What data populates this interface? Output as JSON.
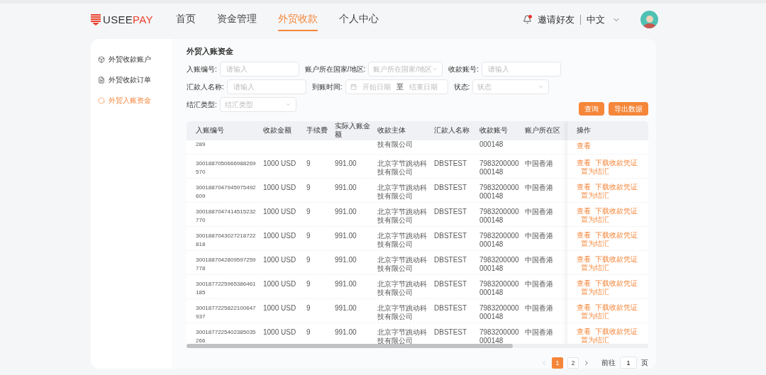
{
  "logo": {
    "parts": [
      "USEE",
      "PAY"
    ]
  },
  "nav": [
    {
      "label": "首页",
      "selected": false
    },
    {
      "label": "资金管理",
      "selected": false
    },
    {
      "label": "外贸收款",
      "selected": true
    },
    {
      "label": "个人中心",
      "selected": false
    }
  ],
  "header": {
    "invite": "邀请好友",
    "unread": true,
    "language": "中文"
  },
  "sidebar": {
    "items": [
      {
        "label": "外贸收款账户",
        "selected": false
      },
      {
        "label": "外贸收款订单",
        "selected": false
      },
      {
        "label": "外贸入账资金",
        "selected": true
      }
    ]
  },
  "page_title": "外贸入账资金",
  "filters": [
    {
      "kind": "input",
      "label": "入账编号:",
      "placeholder": "请输入"
    },
    {
      "kind": "select",
      "label": "账户所在国家/地区:",
      "placeholder": "账户所在国家/地区"
    },
    {
      "kind": "input",
      "label": "收款账号:",
      "placeholder": "请输入"
    },
    {
      "kind": "input",
      "label": "汇款人名称:",
      "placeholder": "请输入"
    },
    {
      "kind": "daterange",
      "label": "到账时间:",
      "start": "开始日期",
      "separator": "至",
      "end": "结束日期"
    },
    {
      "kind": "select",
      "label": "状态:",
      "placeholder": "状态"
    },
    {
      "kind": "select",
      "label": "结汇类型:",
      "placeholder": "结汇类型"
    }
  ],
  "buttons": [
    "查询",
    "导出数据"
  ],
  "table": {
    "columns": [
      "入账编号",
      "收款金额",
      "手续费",
      "实际入账金额",
      "收款主体",
      "汇款人名称",
      "收款账号",
      "账户所在区",
      "操作"
    ],
    "rows": [
      {
        "cells": [
          "289",
          "",
          "",
          "",
          "技有限公司",
          "",
          "000148",
          ""
        ],
        "actions": [
          "查看"
        ],
        "partial": true
      },
      {
        "cells": [
          "3001887050666988269570",
          "1000 USD",
          "9",
          "991.00",
          "北京字节跳动科技有限公司",
          "DBSTEST",
          "7983200000000148",
          "中国香港"
        ],
        "actions": [
          "查看",
          "下载收款凭证",
          "置为结汇"
        ],
        "partial": false
      },
      {
        "cells": [
          "3001887047945975492609",
          "1000 USD",
          "9",
          "991.00",
          "北京字节跳动科技有限公司",
          "DBSTEST",
          "7983200000000148",
          "中国香港"
        ],
        "actions": [
          "查看",
          "下载收款凭证",
          "置为结汇"
        ],
        "partial": false
      },
      {
        "cells": [
          "3001887047414515232770",
          "1000 USD",
          "9",
          "991.00",
          "北京字节跳动科技有限公司",
          "DBSTEST",
          "7983200000000148",
          "中国香港"
        ],
        "actions": [
          "查看",
          "下载收款凭证",
          "置为结汇"
        ],
        "partial": false
      },
      {
        "cells": [
          "3001887043027218722818",
          "1000 USD",
          "9",
          "991.00",
          "北京字节跳动科技有限公司",
          "DBSTEST",
          "7983200000000148",
          "中国香港"
        ],
        "actions": [
          "查看",
          "下载收款凭证",
          "置为结汇"
        ],
        "partial": false
      },
      {
        "cells": [
          "3001887042809597259778",
          "1000 USD",
          "9",
          "991.00",
          "北京字节跳动科技有限公司",
          "DBSTEST",
          "7983200000000148",
          "中国香港"
        ],
        "actions": [
          "查看",
          "下载收款凭证",
          "置为结汇"
        ],
        "partial": false
      },
      {
        "cells": [
          "3001877225965386461185",
          "1000 USD",
          "9",
          "991.00",
          "北京字节跳动科技有限公司",
          "DBSTEST",
          "7983200000000148",
          "中国香港"
        ],
        "actions": [
          "查看",
          "下载收款凭证",
          "置为结汇"
        ],
        "partial": false
      },
      {
        "cells": [
          "3001877225822100647937",
          "1000 USD",
          "9",
          "991.00",
          "北京字节跳动科技有限公司",
          "DBSTEST",
          "7983200000000148",
          "中国香港"
        ],
        "actions": [
          "查看",
          "下载收款凭证",
          "置为结汇"
        ],
        "partial": false
      },
      {
        "cells": [
          "3001877225402385035266",
          "1000 USD",
          "9",
          "991.00",
          "北京字节跳动科技有限公司",
          "DBSTEST",
          "7983200000000148",
          "中国香港"
        ],
        "actions": [
          "查看",
          "下载收款凭证",
          "置为结汇"
        ],
        "partial": false
      }
    ]
  },
  "pagination": {
    "pages": [
      {
        "label": "1",
        "selected": true
      },
      {
        "label": "2",
        "selected": false
      }
    ],
    "prev_disabled": true,
    "goto_label": "前往",
    "goto_value": "1",
    "page_suffix": "页"
  }
}
